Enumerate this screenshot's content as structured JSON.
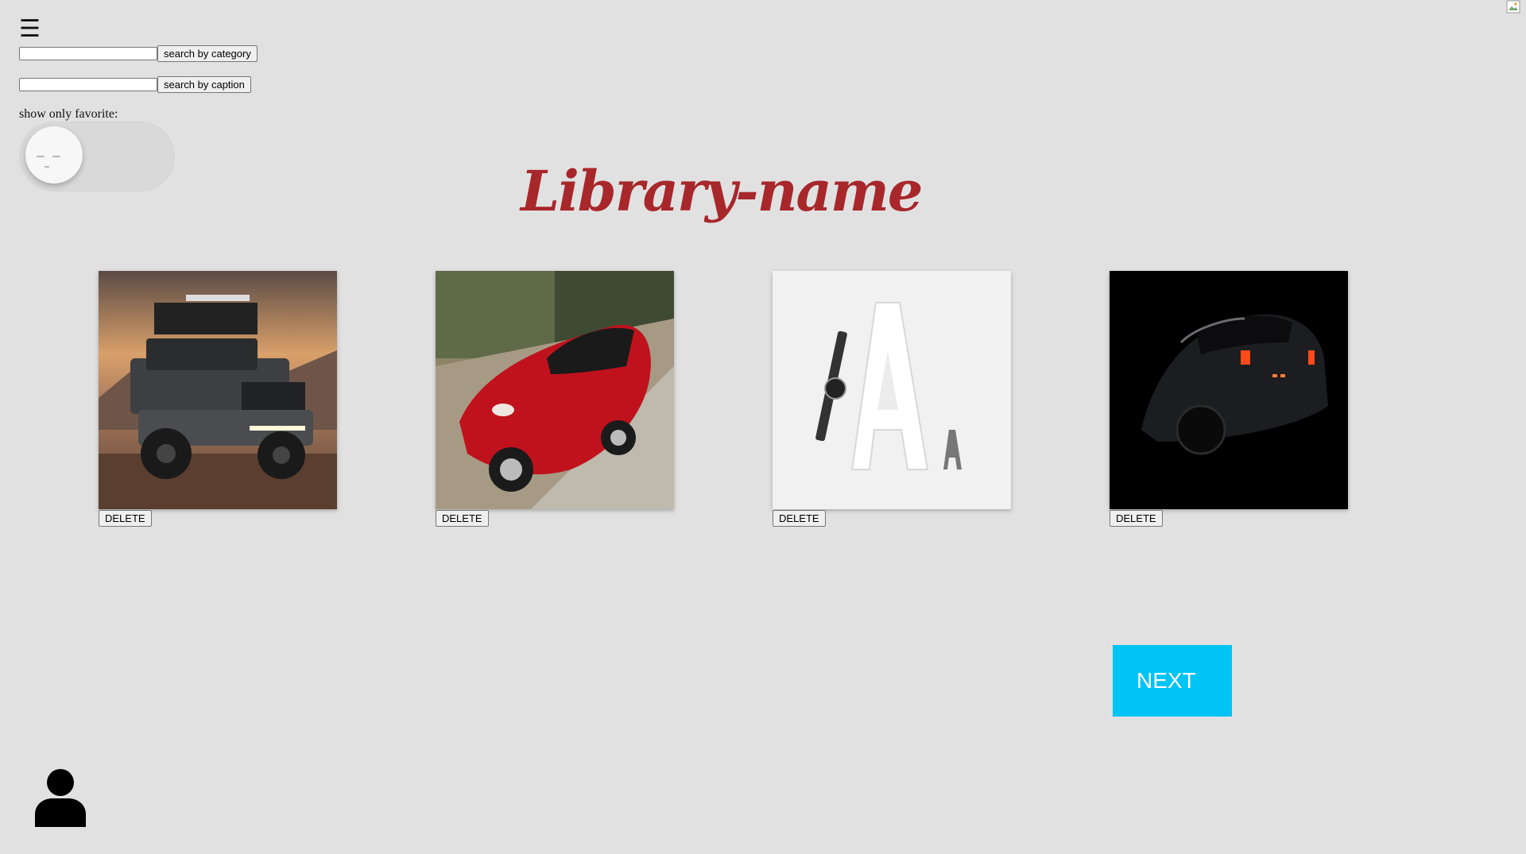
{
  "menu": {
    "icon": "hamburger-menu-icon",
    "glyph": "☰"
  },
  "search": {
    "category": {
      "value": "",
      "placeholder": "",
      "button_label": "search by category"
    },
    "caption": {
      "value": "",
      "placeholder": "",
      "button_label": "search by caption"
    }
  },
  "favorite_filter": {
    "label": "show only favorite:",
    "enabled": false,
    "knob_icon": "sleepy-face-icon"
  },
  "library": {
    "title": "Library-name"
  },
  "gallery": {
    "items": [
      {
        "image_icon": "pickup-truck-photo",
        "delete_label": "DELETE"
      },
      {
        "image_icon": "red-sports-car-photo",
        "delete_label": "DELETE"
      },
      {
        "image_icon": "watch-and-letter-a-photo",
        "delete_label": "DELETE"
      },
      {
        "image_icon": "dark-sports-car-photo",
        "delete_label": "DELETE"
      }
    ]
  },
  "pagination": {
    "next_label": "NEXT"
  },
  "user": {
    "icon": "user-profile-icon"
  },
  "colors": {
    "background": "#e1e1e1",
    "title": "#a8272b",
    "next_button": "#00c3f6",
    "toggle_track": "#d9d9d9"
  }
}
